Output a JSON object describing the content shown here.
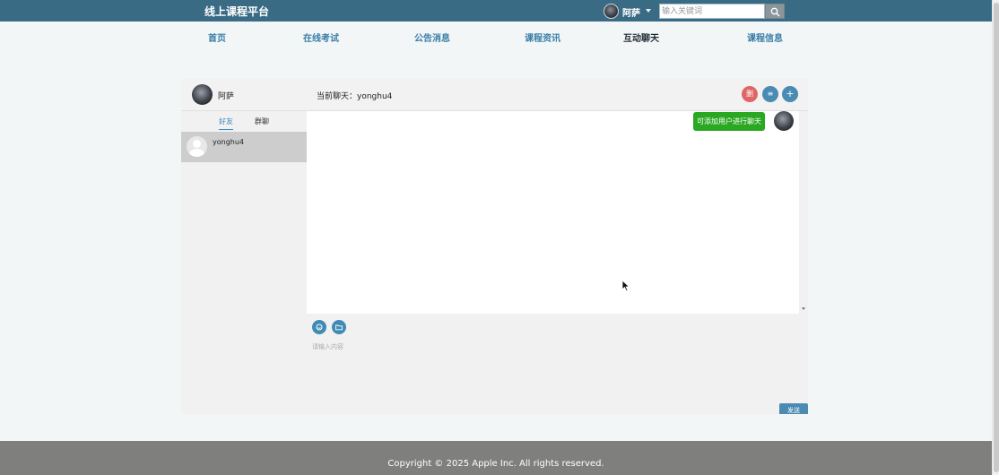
{
  "header": {
    "brand": "线上课程平台",
    "username": "阿萨",
    "search": {
      "placeholder": "输入关键词",
      "value": ""
    }
  },
  "nav": {
    "items": [
      {
        "label": "首页"
      },
      {
        "label": "在线考试"
      },
      {
        "label": "公告消息"
      },
      {
        "label": "课程资讯"
      },
      {
        "label": "互动聊天"
      },
      {
        "label": "课程信息"
      }
    ],
    "active_index": 4
  },
  "chat": {
    "me_name": "阿萨",
    "current_chat": "当前聊天：yonghu4",
    "header_buttons": [
      {
        "icon": "delete-icon",
        "glyph": "删"
      },
      {
        "icon": "list-icon",
        "glyph": "≡"
      },
      {
        "icon": "plus-icon",
        "glyph": "+"
      }
    ],
    "tabs": [
      {
        "label": "好友"
      },
      {
        "label": "群聊"
      }
    ],
    "active_tab": 0,
    "contacts": [
      {
        "name": "yonghu4"
      }
    ],
    "messages": [
      {
        "text": "可添加用户进行聊天"
      }
    ],
    "input_placeholder": "请输入内容",
    "send_label": "发送"
  },
  "footer": {
    "copyright": "Copyright © 2025 Apple Inc. All rights reserved."
  },
  "colors": {
    "topbar": "#3a6b85",
    "accent": "#4a8ab3",
    "message_bubble": "#2aa822",
    "footer": "#7f807d",
    "delete_button": "#e06666"
  }
}
